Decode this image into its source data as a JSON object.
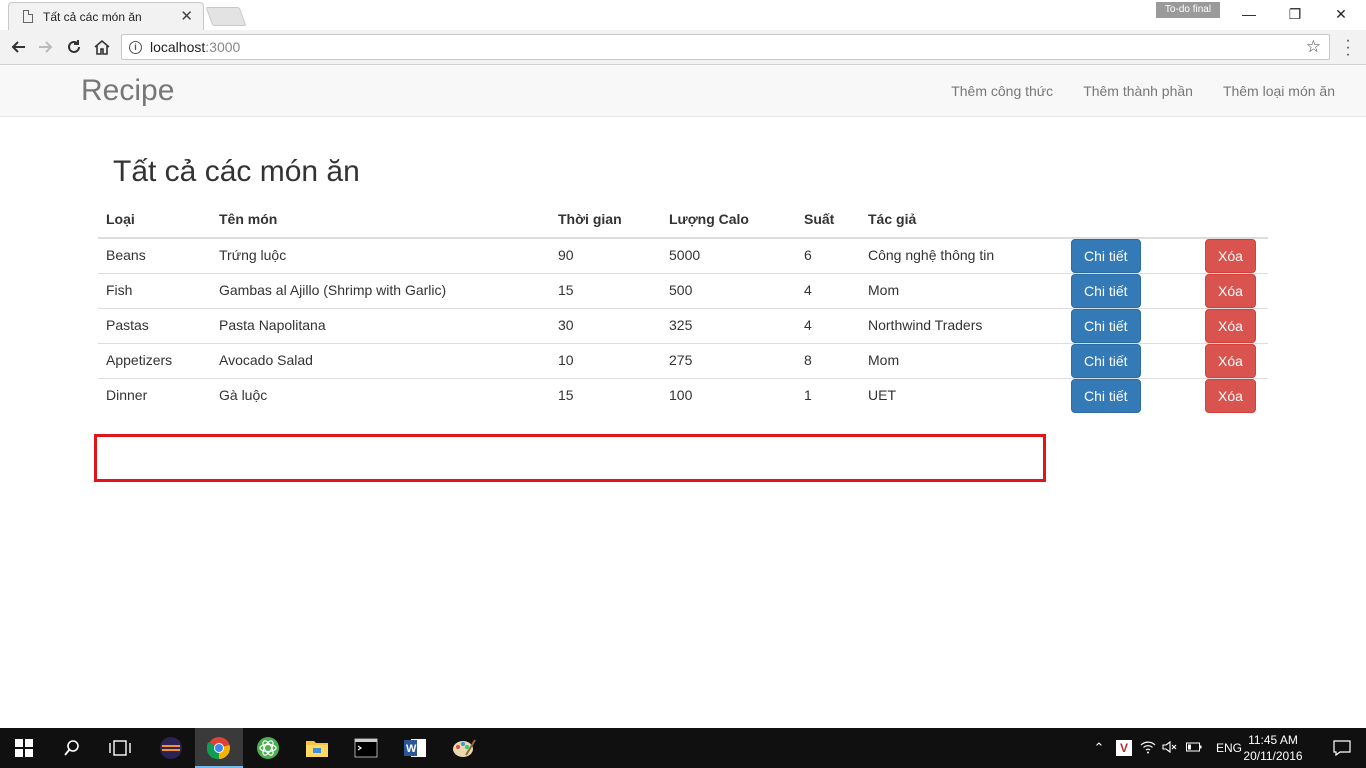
{
  "browser": {
    "tab_title": "Tất cả các món ăn",
    "tab_close": "✕",
    "profile_label": "To-do final",
    "url_host": "localhost",
    "url_port": ":3000",
    "window_controls": {
      "minimize": "—",
      "restore": "❐",
      "close": "✕"
    }
  },
  "navbar": {
    "brand": "Recipe",
    "links": [
      "Thêm công thức",
      "Thêm thành phần",
      "Thêm loại món ăn"
    ]
  },
  "page": {
    "title": "Tất cả các món ăn",
    "columns": [
      "Loại",
      "Tên món",
      "Thời gian",
      "Lượng Calo",
      "Suất",
      "Tác giả"
    ],
    "detail_label": "Chi tiết",
    "delete_label": "Xóa",
    "rows": [
      {
        "category": "Beans",
        "name": "Trứng luộc",
        "time": "90",
        "calories": "5000",
        "servings": "6",
        "author": "Công nghệ thông tin"
      },
      {
        "category": "Fish",
        "name": "Gambas al Ajillo (Shrimp with Garlic)",
        "time": "15",
        "calories": "500",
        "servings": "4",
        "author": "Mom"
      },
      {
        "category": "Pastas",
        "name": "Pasta Napolitana",
        "time": "30",
        "calories": "325",
        "servings": "4",
        "author": "Northwind Traders"
      },
      {
        "category": "Appetizers",
        "name": "Avocado Salad",
        "time": "10",
        "calories": "275",
        "servings": "8",
        "author": "Mom"
      },
      {
        "category": "Dinner",
        "name": "Gà luộc",
        "time": "15",
        "calories": "100",
        "servings": "1",
        "author": "UET"
      }
    ]
  },
  "taskbar": {
    "language": "ENG",
    "time": "11:45 AM",
    "date": "20/11/2016"
  },
  "colors": {
    "primary": "#337ab7",
    "danger": "#d9534f",
    "highlight": "#e0141b"
  }
}
